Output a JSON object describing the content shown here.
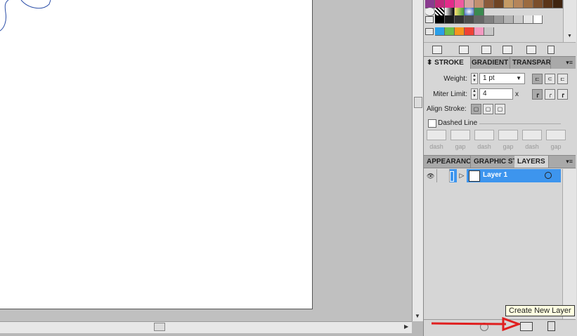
{
  "panels": {
    "stroke_group": {
      "tabs": [
        {
          "label": "STROKE",
          "active": true
        },
        {
          "label": "GRADIENT",
          "active": false
        },
        {
          "label": "TRANSPAR",
          "active": false
        }
      ],
      "weight_label": "Weight:",
      "weight_value": "1 pt",
      "miter_label": "Miter Limit:",
      "miter_value": "4",
      "miter_unit": "x",
      "align_label": "Align Stroke:",
      "dashed_label": "Dashed Line",
      "dash_labels": [
        "dash",
        "gap",
        "dash",
        "gap",
        "dash",
        "gap"
      ]
    },
    "layers_group": {
      "tabs": [
        {
          "label": "APPEARANC",
          "active": false
        },
        {
          "label": "GRAPHIC ST",
          "active": false
        },
        {
          "label": "LAYERS",
          "active": true
        }
      ],
      "layer_name": "Layer 1"
    }
  },
  "tooltip": "Create New Layer",
  "colors": {
    "selection": "#3d95ee",
    "arrow": "#e02020"
  }
}
